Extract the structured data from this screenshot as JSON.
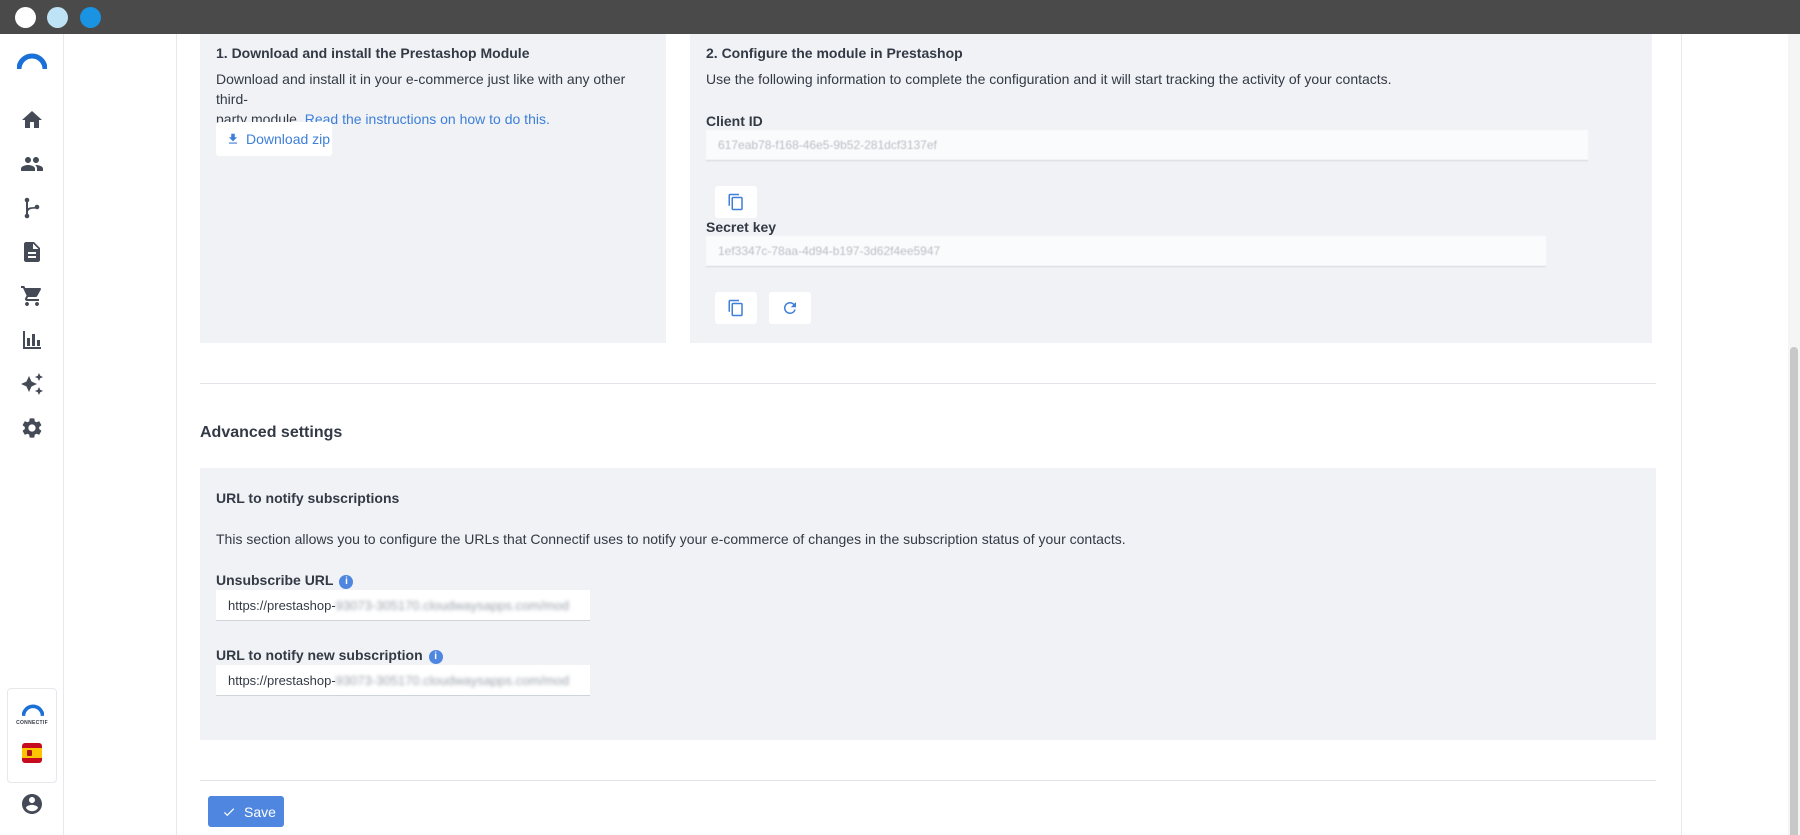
{
  "window": {
    "controls": [
      "close",
      "minimize",
      "maximize"
    ]
  },
  "sidebar": {
    "items": [
      {
        "icon": "home-icon"
      },
      {
        "icon": "contacts-icon"
      },
      {
        "icon": "workflow-icon"
      },
      {
        "icon": "document-icon"
      },
      {
        "icon": "cart-icon"
      },
      {
        "icon": "analytics-icon"
      },
      {
        "icon": "sparkle-icon"
      },
      {
        "icon": "settings-icon"
      }
    ],
    "brand_text": "CONNECTIF",
    "language_flag": "spain-flag"
  },
  "step1": {
    "title": "1. Download and install the Prestashop Module",
    "text_line1": "Download and install it in your e-commerce just like with any other third-",
    "text_line2": "party module.",
    "link": "Read the instructions on how to do this.",
    "download_label": "Download zip"
  },
  "step2": {
    "title": "2. Configure the module in Prestashop",
    "text": "Use the following information to complete the configuration and it will start tracking the activity of your contacts.",
    "client_id_label": "Client ID",
    "client_id_value": "617eab78-f168-46e5-9b52-281dcf3137ef",
    "secret_key_label": "Secret key",
    "secret_key_value": "1ef3347c-78aa-4d94-b197-3d62f4ee5947"
  },
  "advanced": {
    "title": "Advanced settings",
    "subtitle": "URL to notify subscriptions",
    "description": "This section allows you to configure the URLs that Connectif uses to notify your e-commerce of changes in the subscription status of your contacts.",
    "unsubscribe_label": "Unsubscribe URL",
    "unsubscribe_prefix": "https://prestashop-",
    "unsubscribe_rest": "93073-305170.cloudwaysapps.com/mod",
    "new_sub_label": "URL to notify new subscription",
    "new_sub_prefix": "https://prestashop-",
    "new_sub_rest": "93073-305170.cloudwaysapps.com/mod"
  },
  "footer": {
    "save_label": "Save"
  },
  "colors": {
    "accent": "#4f87e0",
    "link": "#3d7fd9",
    "card_bg": "#f0f2f5"
  }
}
